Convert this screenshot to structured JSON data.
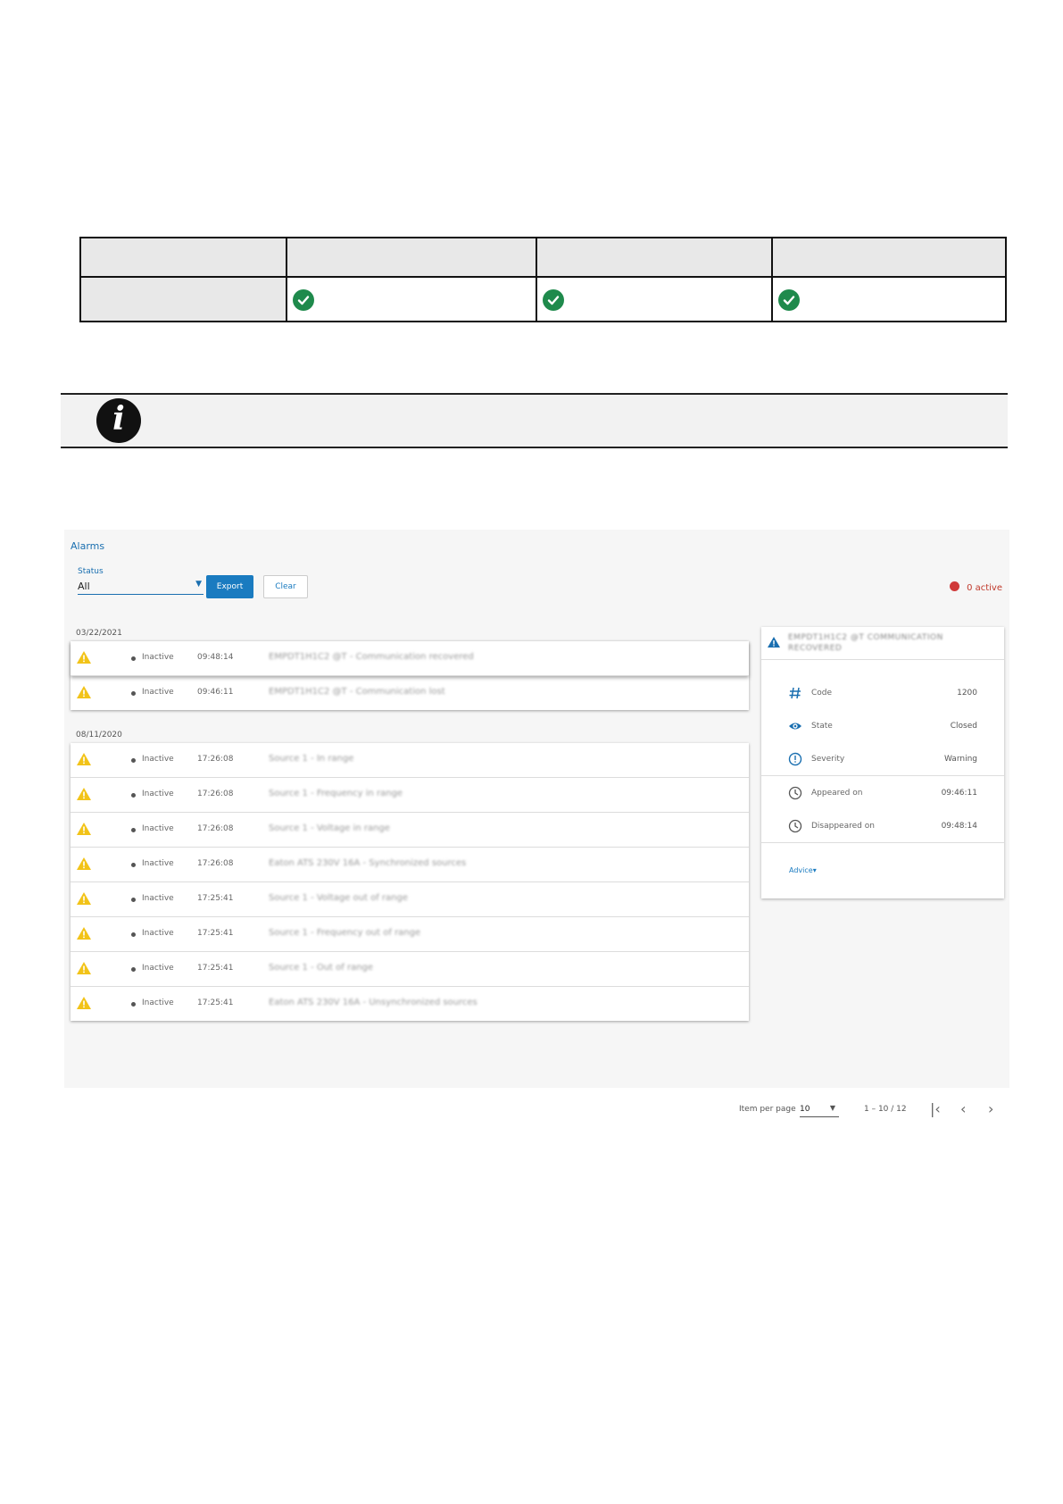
{
  "alarms_ui": {
    "title": "Alarms",
    "status_label": "Status",
    "status_value": "All",
    "export_label": "Export",
    "clear_label": "Clear",
    "active_count": "0 active",
    "groups": [
      {
        "date": "03/22/2021",
        "rows": [
          {
            "state": "Inactive",
            "time": "09:48:14",
            "desc": "EMPDT1H1C2 @T - Communication recovered"
          },
          {
            "state": "Inactive",
            "time": "09:46:11",
            "desc": "EMPDT1H1C2 @T - Communication lost"
          }
        ]
      },
      {
        "date": "08/11/2020",
        "rows": [
          {
            "state": "Inactive",
            "time": "17:26:08",
            "desc": "Source 1 - In range"
          },
          {
            "state": "Inactive",
            "time": "17:26:08",
            "desc": "Source 1 - Frequency in range"
          },
          {
            "state": "Inactive",
            "time": "17:26:08",
            "desc": "Source 1 - Voltage in range"
          },
          {
            "state": "Inactive",
            "time": "17:26:08",
            "desc": "Eaton ATS 230V 16A - Synchronized sources"
          },
          {
            "state": "Inactive",
            "time": "17:25:41",
            "desc": "Source 1 - Voltage out of range"
          },
          {
            "state": "Inactive",
            "time": "17:25:41",
            "desc": "Source 1 - Frequency out of range"
          },
          {
            "state": "Inactive",
            "time": "17:25:41",
            "desc": "Source 1 - Out of range"
          },
          {
            "state": "Inactive",
            "time": "17:25:41",
            "desc": "Eaton ATS 230V 16A - Unsynchronized sources"
          }
        ]
      }
    ],
    "detail": {
      "title": "EMPDT1H1C2 @T COMMUNICATION RECOVERED",
      "code_label": "Code",
      "code_value": "1200",
      "state_label": "State",
      "state_value": "Closed",
      "severity_label": "Severity",
      "severity_value": "Warning",
      "appeared_label": "Appeared on",
      "appeared_value": "09:46:11",
      "disappeared_label": "Disappeared on",
      "disappeared_value": "09:48:14",
      "advice_label": "Advice"
    },
    "pager": {
      "items_per_page_label": "Item per page",
      "items_per_page_value": "10",
      "range": "1 – 10 / 12"
    }
  },
  "colors": {
    "accent": "#1a7bc0",
    "check_green": "#1f8a4c",
    "warning_yellow": "#f2c318",
    "alarm_red": "#d03a3a"
  }
}
